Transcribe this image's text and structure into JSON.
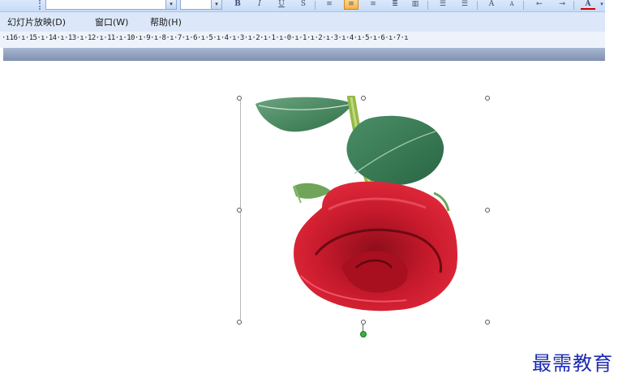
{
  "menubar": {
    "items": [
      {
        "label": "幻灯片放映(D)"
      },
      {
        "label": "窗口(W)"
      },
      {
        "label": "帮助(H)"
      }
    ]
  },
  "ruler": {
    "labels": "·ı16·ı·15·ı·14·ı·13·ı·12·ı·11·ı·10·ı·9·ı·8·ı·7·ı·6·ı·5·ı·4·ı·3·ı·2·ı·1·ı·0·ı·1·ı·2·ı·3·ı·4·ı·5·ı·6·ı·7·ı"
  },
  "toolbar": {
    "icons": [
      "bold-icon",
      "italic-icon",
      "underline-icon",
      "shadow-icon",
      "align-left-icon",
      "align-center-icon",
      "align-right-icon",
      "justify-icon",
      "columns-icon",
      "numbering-icon",
      "bullets-icon",
      "increase-font-icon",
      "decrease-font-icon",
      "decrease-indent-icon",
      "increase-indent-icon",
      "font-color-icon"
    ],
    "active_color": "#f8b048"
  },
  "selection": {
    "handle_color": "#555555",
    "rotate_handle_color": "#2fb53a"
  },
  "watermark": {
    "text": "最需教育",
    "color": "#1c2bb0"
  }
}
